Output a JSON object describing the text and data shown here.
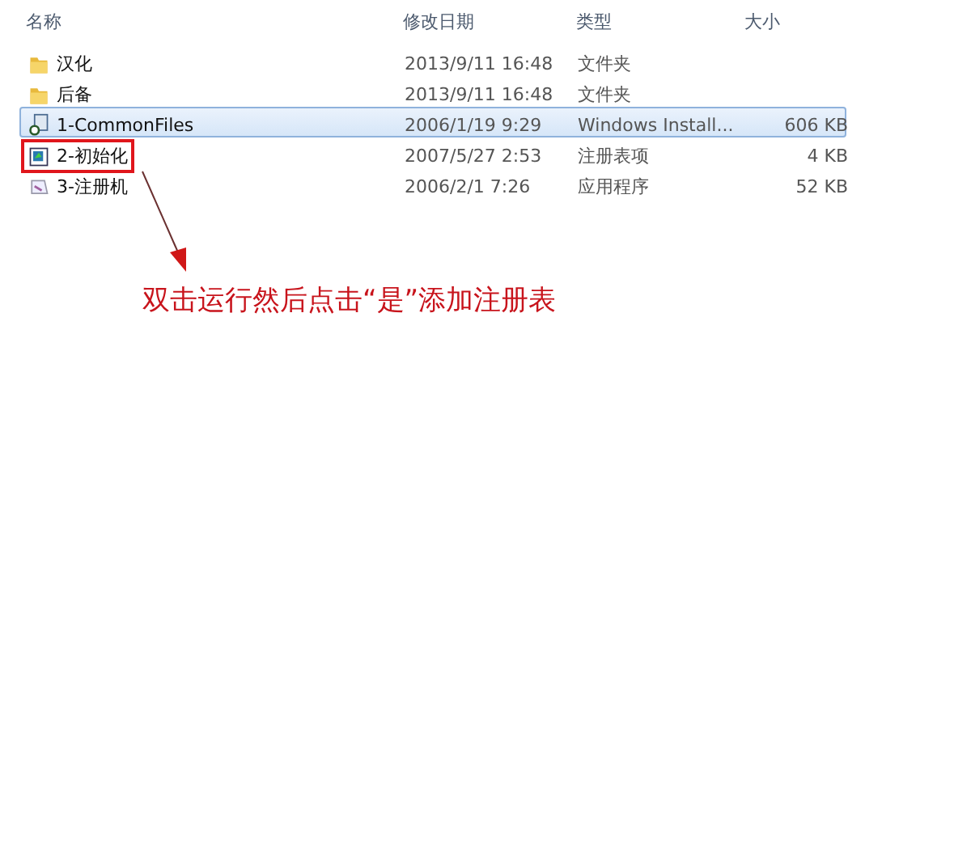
{
  "columns": [
    "名称",
    "修改日期",
    "类型",
    "大小"
  ],
  "rows": [
    {
      "kind": "folder",
      "name": "汉化",
      "date": "2013/9/11 16:48",
      "type": "文件夹",
      "selected": false,
      "highlighted": false
    },
    {
      "kind": "folder",
      "name": "后备",
      "date": "2013/9/11 16:48",
      "type": "文件夹",
      "selected": false,
      "highlighted": false
    },
    {
      "kind": "installer",
      "name": "1-CommonFiles",
      "date": "2006/1/19 9:29",
      "type": "Windows Install...",
      "size": "606 KB",
      "selected": true,
      "highlighted": false
    },
    {
      "kind": "registry",
      "name": "2-初始化",
      "date": "2007/5/27 2:53",
      "type": "注册表项",
      "size": "4 KB",
      "selected": false,
      "highlighted": true
    },
    {
      "kind": "program",
      "name": "3-注册机",
      "date": "2006/2/1 7:26",
      "type": "应用程序",
      "size": "52 KB",
      "selected": false,
      "highlighted": false
    }
  ],
  "annotation": "双击运行然后点击“是”添加注册表"
}
